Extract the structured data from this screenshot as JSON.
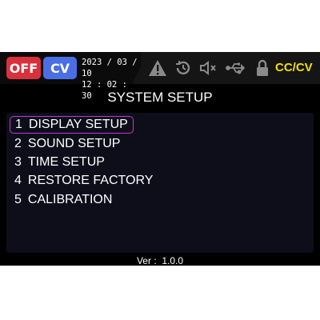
{
  "status_bar": {
    "output_state": "OFF",
    "mode": "CV",
    "date": "2023 / 03 / 10",
    "time": "12 : 02 : 30",
    "icons": [
      "warning-icon",
      "timer-icon",
      "speaker-muted-icon",
      "usb-icon",
      "lock-icon"
    ],
    "regulation_mode": "CC/CV"
  },
  "page": {
    "title": "SYSTEM SETUP",
    "selected_index": 0
  },
  "menu": {
    "items": [
      {
        "number": "1",
        "label": "DISPLAY SETUP"
      },
      {
        "number": "2",
        "label": "SOUND SETUP"
      },
      {
        "number": "3",
        "label": "TIME SETUP"
      },
      {
        "number": "4",
        "label": "RESTORE FACTORY"
      },
      {
        "number": "5",
        "label": "CALIBRATION"
      }
    ]
  },
  "footer": {
    "version_label": "Ver :",
    "version_value": "1.0.0"
  },
  "colors": {
    "off_badge": "#d8313c",
    "cv_badge": "#4a6ee4",
    "cccv_text": "#f4e000",
    "selection_border": "#c437d6",
    "icon_gray": "#8a8a8a"
  }
}
